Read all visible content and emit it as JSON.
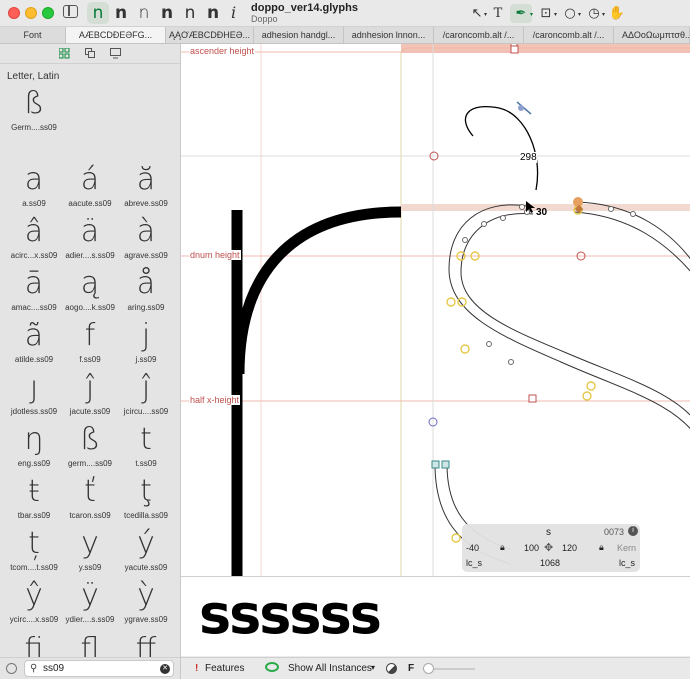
{
  "window": {
    "title": "doppo_ver14.glyphs",
    "subtitle": "Doppo"
  },
  "toolbar": {
    "weight_icons": [
      "n",
      "n",
      "n",
      "n",
      "n",
      "n",
      "n"
    ],
    "info_icon": "i",
    "tools": [
      {
        "icon": "select-tool-icon",
        "glyph": "↖"
      },
      {
        "icon": "text-tool-icon",
        "glyph": "T"
      },
      {
        "icon": "pen-tool-icon",
        "glyph": "✒"
      },
      {
        "icon": "shape-tool-icon",
        "glyph": "⊡"
      },
      {
        "icon": "ellipse-tool-icon",
        "glyph": "○"
      },
      {
        "icon": "measure-tool-icon",
        "glyph": "◷"
      },
      {
        "icon": "hand-tool-icon",
        "glyph": "✋"
      }
    ]
  },
  "tabs": [
    {
      "label": "Font"
    },
    {
      "label": "AÆBCDÐEƏFG..."
    },
    {
      "label": "ĄĄƠÆBCDÐHEƏ..."
    },
    {
      "label": "adhesion handgl..."
    },
    {
      "label": "adnhesion lnnon..."
    },
    {
      "label": "/caroncomb.alt /..."
    },
    {
      "label": "/caroncomb.alt /..."
    },
    {
      "label": "AΔΟοΩωμπτσθ..."
    }
  ],
  "sidebar": {
    "section_title": "Letter, Latin",
    "glyphs": [
      {
        "char": "ß",
        "name": "Germ....ss09"
      },
      {
        "char": "a",
        "name": "a.ss09"
      },
      {
        "char": "á",
        "name": "aacute.ss09"
      },
      {
        "char": "ă",
        "name": "abreve.ss09"
      },
      {
        "char": "â",
        "name": "acirc...x.ss09"
      },
      {
        "char": "ä",
        "name": "adier....s.ss09"
      },
      {
        "char": "à",
        "name": "agrave.ss09"
      },
      {
        "char": "ā",
        "name": "amac....ss09"
      },
      {
        "char": "ą",
        "name": "aogo....k.ss09"
      },
      {
        "char": "å",
        "name": "aring.ss09"
      },
      {
        "char": "ã",
        "name": "atilde.ss09"
      },
      {
        "char": "f",
        "name": "f.ss09"
      },
      {
        "char": "j",
        "name": "j.ss09"
      },
      {
        "char": "ȷ",
        "name": "jdotless.ss09"
      },
      {
        "char": "ĵ",
        "name": "jacute.ss09"
      },
      {
        "char": "ĵ",
        "name": "jcircu....ss09"
      },
      {
        "char": "ŋ",
        "name": "eng.ss09"
      },
      {
        "char": "ß",
        "name": "germ....ss09"
      },
      {
        "char": "t",
        "name": "t.ss09"
      },
      {
        "char": "ŧ",
        "name": "tbar.ss09"
      },
      {
        "char": "ť",
        "name": "tcaron.ss09"
      },
      {
        "char": "ţ",
        "name": "tcedilla.ss09"
      },
      {
        "char": "ț",
        "name": "tcom....t.ss09"
      },
      {
        "char": "y",
        "name": "y.ss09"
      },
      {
        "char": "ý",
        "name": "yacute.ss09"
      },
      {
        "char": "ŷ",
        "name": "ycirc....x.ss09"
      },
      {
        "char": "ÿ",
        "name": "ydier....s.ss09"
      },
      {
        "char": "ỳ",
        "name": "ygrave.ss09"
      },
      {
        "char": "fi",
        "name": ""
      },
      {
        "char": "fl",
        "name": ""
      },
      {
        "char": "ff",
        "name": ""
      }
    ],
    "search_value": "ss09"
  },
  "canvas": {
    "metric_labels": {
      "ascender": "ascender height",
      "dnum": "dnum height",
      "half_x": "half x-height"
    },
    "measure_values": {
      "curve": "298",
      "handle": "30"
    },
    "colors": {
      "metric": "#c0504d",
      "highlight": "#f2d9cf",
      "node_yellow": "#e6c84a",
      "accent": "#0a7a3a"
    }
  },
  "info_box": {
    "glyph_name": "s",
    "unicode": "0073",
    "lsb": "-40",
    "width_left": "100",
    "width_right": "120",
    "kern_label": "Kern",
    "left_group": "lc_s",
    "advance": "1068",
    "right_group": "lc_s"
  },
  "preview": {
    "text": "ssssss"
  },
  "bottombar": {
    "features_label": "Features",
    "instances_label": "Show All Instances",
    "f_label": "F"
  }
}
